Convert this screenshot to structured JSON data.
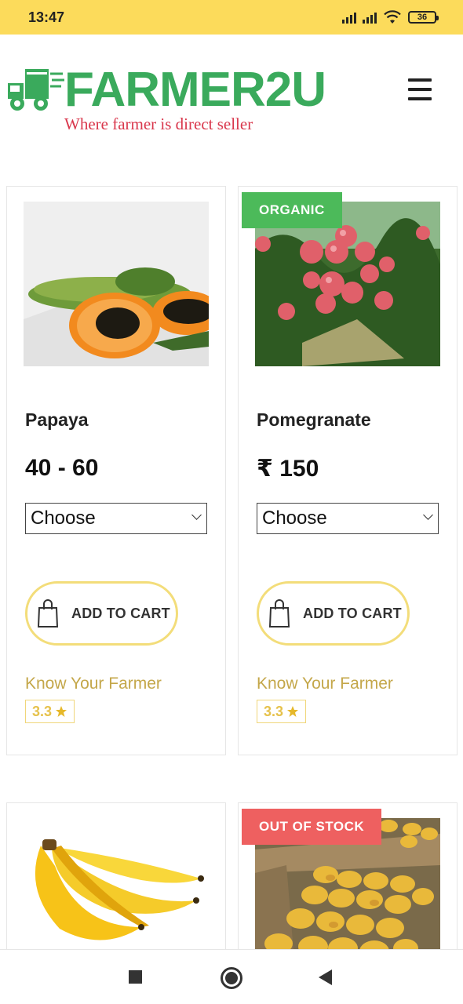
{
  "status_bar": {
    "time": "13:47",
    "battery": "36"
  },
  "header": {
    "logo_text": "FARMER2U",
    "tagline": "Where farmer is direct seller",
    "menu_icon": "hamburger-icon"
  },
  "products": [
    {
      "name": "Papaya",
      "price": "40 - 60",
      "select_value": "Choose",
      "cart_label": "ADD TO CART",
      "farmer_link": "Know Your Farmer",
      "rating": "3.3",
      "badge": ""
    },
    {
      "name": "Pomegranate",
      "price": "₹ 150",
      "select_value": "Choose",
      "cart_label": "ADD TO CART",
      "farmer_link": "Know Your Farmer",
      "rating": "3.3",
      "badge": "ORGANIC"
    },
    {
      "name": "",
      "badge": ""
    },
    {
      "name": "",
      "badge": "OUT OF STOCK"
    }
  ],
  "colors": {
    "status_bar": "#fcdb5b",
    "logo_green": "#3aaa5c",
    "tagline_red": "#d9374c",
    "organic_badge": "#4cba5a",
    "out_of_stock_badge": "#ee6060",
    "accent_gold": "#c4a74a"
  }
}
